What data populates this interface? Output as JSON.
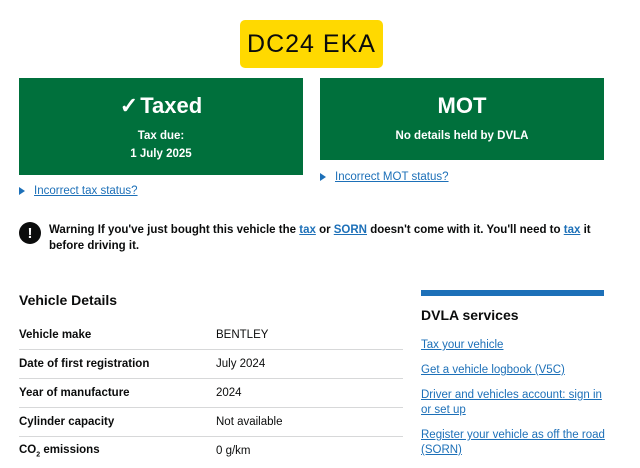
{
  "registration": "DC24 EKA",
  "tax": {
    "tick": "✓",
    "status": "Taxed",
    "due_label": "Tax due:",
    "due_date": "1 July 2025",
    "link": "Incorrect tax status?"
  },
  "mot": {
    "status": "MOT",
    "detail": "No details held by DVLA",
    "link": "Incorrect MOT status?"
  },
  "warning": {
    "icon": "!",
    "prefix": "Warning If you've just bought this vehicle the",
    "tax_link": "tax",
    "or": "or",
    "sorn_link": "SORN",
    "middle": "doesn't come with it. You'll need to",
    "tax_link2": "tax",
    "suffix": "it before driving it."
  },
  "vehicle_details": {
    "title": "Vehicle Details",
    "rows": [
      {
        "label": "Vehicle make",
        "value": "BENTLEY"
      },
      {
        "label": "Date of first registration",
        "value": "July 2024"
      },
      {
        "label": "Year of manufacture",
        "value": "2024"
      },
      {
        "label": "Cylinder capacity",
        "value": "Not available"
      },
      {
        "label_main": "CO",
        "label_sub": "2",
        "label_rest": " emissions",
        "value": "0 g/km"
      }
    ]
  },
  "dvla_services": {
    "title": "DVLA services",
    "links": [
      "Tax your vehicle",
      "Get a vehicle logbook (V5C)",
      "Driver and vehicles account: sign in or set up",
      "Register your vehicle as off the road (SORN)"
    ]
  },
  "colors": {
    "green": "#00703c",
    "link_blue": "#1d70b8",
    "plate_yellow": "#ffd900"
  }
}
